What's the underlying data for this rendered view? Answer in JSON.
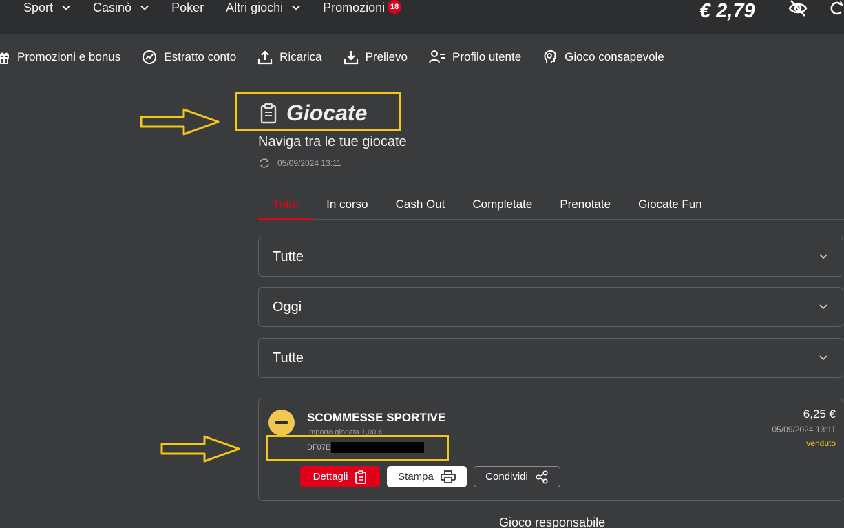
{
  "topnav": {
    "items": [
      {
        "label": "Sport",
        "has_dropdown": true
      },
      {
        "label": "Casinò",
        "has_dropdown": true
      },
      {
        "label": "Poker",
        "has_dropdown": false
      },
      {
        "label": "Altri giochi",
        "has_dropdown": true
      },
      {
        "label": "Promozioni",
        "has_dropdown": false
      }
    ],
    "promo_badge": "18",
    "balance": "€ 2,79",
    "icons": [
      "chevron-down-icon",
      "eye-off-icon",
      "refresh-icon"
    ]
  },
  "subnav": {
    "items": [
      {
        "label": "Promozioni e bonus",
        "icon": "gift-icon"
      },
      {
        "label": "Estratto conto",
        "icon": "trend-icon"
      },
      {
        "label": "Ricarica",
        "icon": "upload-icon"
      },
      {
        "label": "Prelievo",
        "icon": "download-icon"
      },
      {
        "label": "Profilo utente",
        "icon": "user-profile-icon"
      },
      {
        "label": "Gioco consapevole",
        "icon": "head-icon"
      }
    ]
  },
  "page": {
    "title": "Giocate",
    "subtitle": "Naviga tra le tue giocate",
    "updated": "05/09/2024 13:11"
  },
  "tabs": [
    {
      "label": "Tutte",
      "active": true
    },
    {
      "label": "In corso",
      "active": false
    },
    {
      "label": "Cash Out",
      "active": false
    },
    {
      "label": "Completate",
      "active": false
    },
    {
      "label": "Prenotate",
      "active": false
    },
    {
      "label": "Giocate Fun",
      "active": false
    }
  ],
  "filters": [
    {
      "value": "Tutte"
    },
    {
      "value": "Oggi"
    },
    {
      "value": "Tutte"
    }
  ],
  "bet": {
    "title": "SCOMMESSE SPORTIVE",
    "amount": "Importo giocata 1,00 €",
    "code": "DF07E",
    "win": "6,25 €",
    "date": "05/09/2024 13:11",
    "status": "venduto",
    "buttons": {
      "details": "Dettagli",
      "print": "Stampa",
      "share": "Condividi"
    }
  },
  "footer": {
    "text": "Gioco responsabile"
  },
  "colors": {
    "accent": "#e0001a",
    "highlight": "#f5c518",
    "background": "#3a3b3d",
    "topbar": "#2d2e30"
  }
}
